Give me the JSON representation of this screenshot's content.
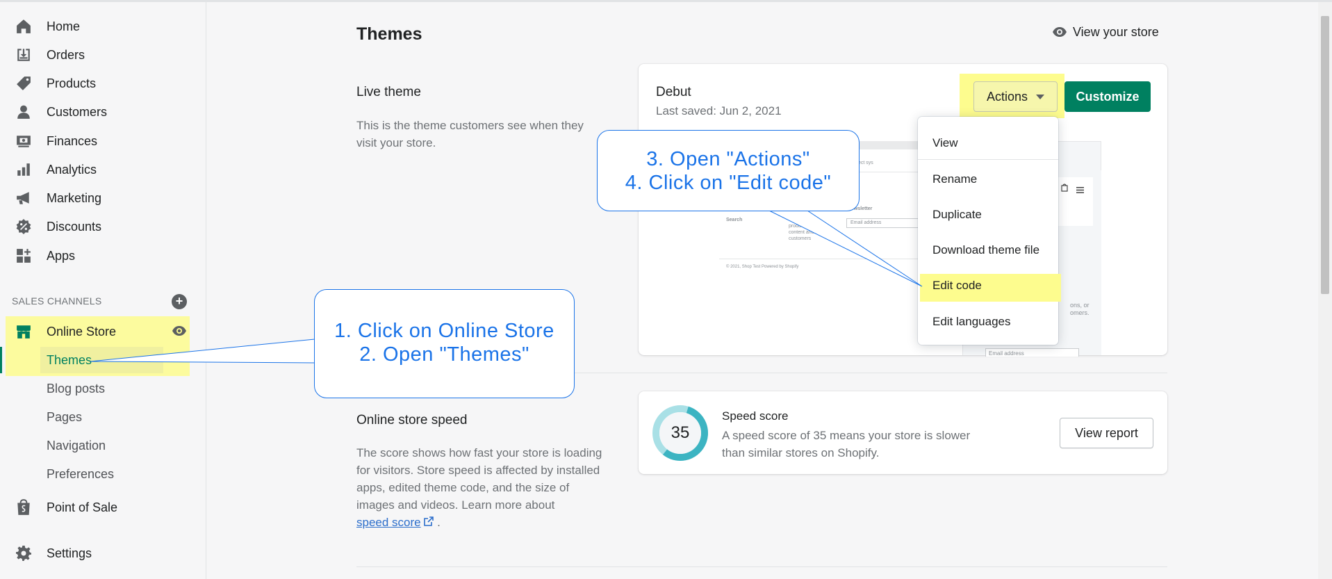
{
  "sidebar": {
    "items": [
      {
        "label": "Home",
        "icon": "home-icon"
      },
      {
        "label": "Orders",
        "icon": "orders-icon"
      },
      {
        "label": "Products",
        "icon": "tag-icon"
      },
      {
        "label": "Customers",
        "icon": "person-icon"
      },
      {
        "label": "Finances",
        "icon": "finances-icon"
      },
      {
        "label": "Analytics",
        "icon": "bar-chart-icon"
      },
      {
        "label": "Marketing",
        "icon": "megaphone-icon"
      },
      {
        "label": "Discounts",
        "icon": "discount-icon"
      },
      {
        "label": "Apps",
        "icon": "apps-icon"
      }
    ],
    "sales_channels_title": "SALES CHANNELS",
    "online_store": {
      "label": "Online Store"
    },
    "sub_items": [
      {
        "label": "Themes"
      },
      {
        "label": "Blog posts"
      },
      {
        "label": "Pages"
      },
      {
        "label": "Navigation"
      },
      {
        "label": "Preferences"
      }
    ],
    "point_of_sale": {
      "label": "Point of Sale"
    },
    "settings": {
      "label": "Settings"
    }
  },
  "header": {
    "title": "Themes",
    "view_store": "View your store"
  },
  "live_theme": {
    "title": "Live theme",
    "description": "This is the theme customers see when they visit your store.",
    "theme_name": "Debut",
    "last_saved": "Last saved: Jun 2, 2021",
    "actions_label": "Actions",
    "customize_label": "Customize"
  },
  "preview": {
    "search": "Search",
    "newsletter": "Newsletter",
    "email_placeholder": "Email address",
    "footer": "© 2021, Shop Test Powered by Shopify",
    "body_lines": [
      "products",
      "content and",
      "customers"
    ],
    "right_lines": [
      "ons, or",
      "omers."
    ],
    "right_email": "Email address",
    "top_text": "ect sys"
  },
  "actions_menu": {
    "items": [
      "View",
      "Rename",
      "Duplicate",
      "Download theme file",
      "Edit code",
      "Edit languages"
    ]
  },
  "speed": {
    "title": "Online store speed",
    "description": "The score shows how fast your store is loading for visitors. Store speed is affected by installed apps, edited theme code, and the size of images and videos. Learn more about",
    "link_text": "speed score",
    "link_suffix": ".",
    "score": "35",
    "score_fraction": 0.35,
    "card_title": "Speed score",
    "card_text": "A speed score of 35 means your store is slower than similar stores on Shopify.",
    "report_label": "View report"
  },
  "callouts": {
    "first_line1": "1. Click on Online Store",
    "first_line2": "2. Open \"Themes\"",
    "second_line1": "3. Open \"Actions\"",
    "second_line2": "4. Click on \"Edit code\""
  },
  "colors": {
    "accent_green": "#008060",
    "highlight_yellow": "#fdfc8e",
    "callout_blue": "#1a73e8",
    "gauge_teal": "#3cb4c2"
  }
}
